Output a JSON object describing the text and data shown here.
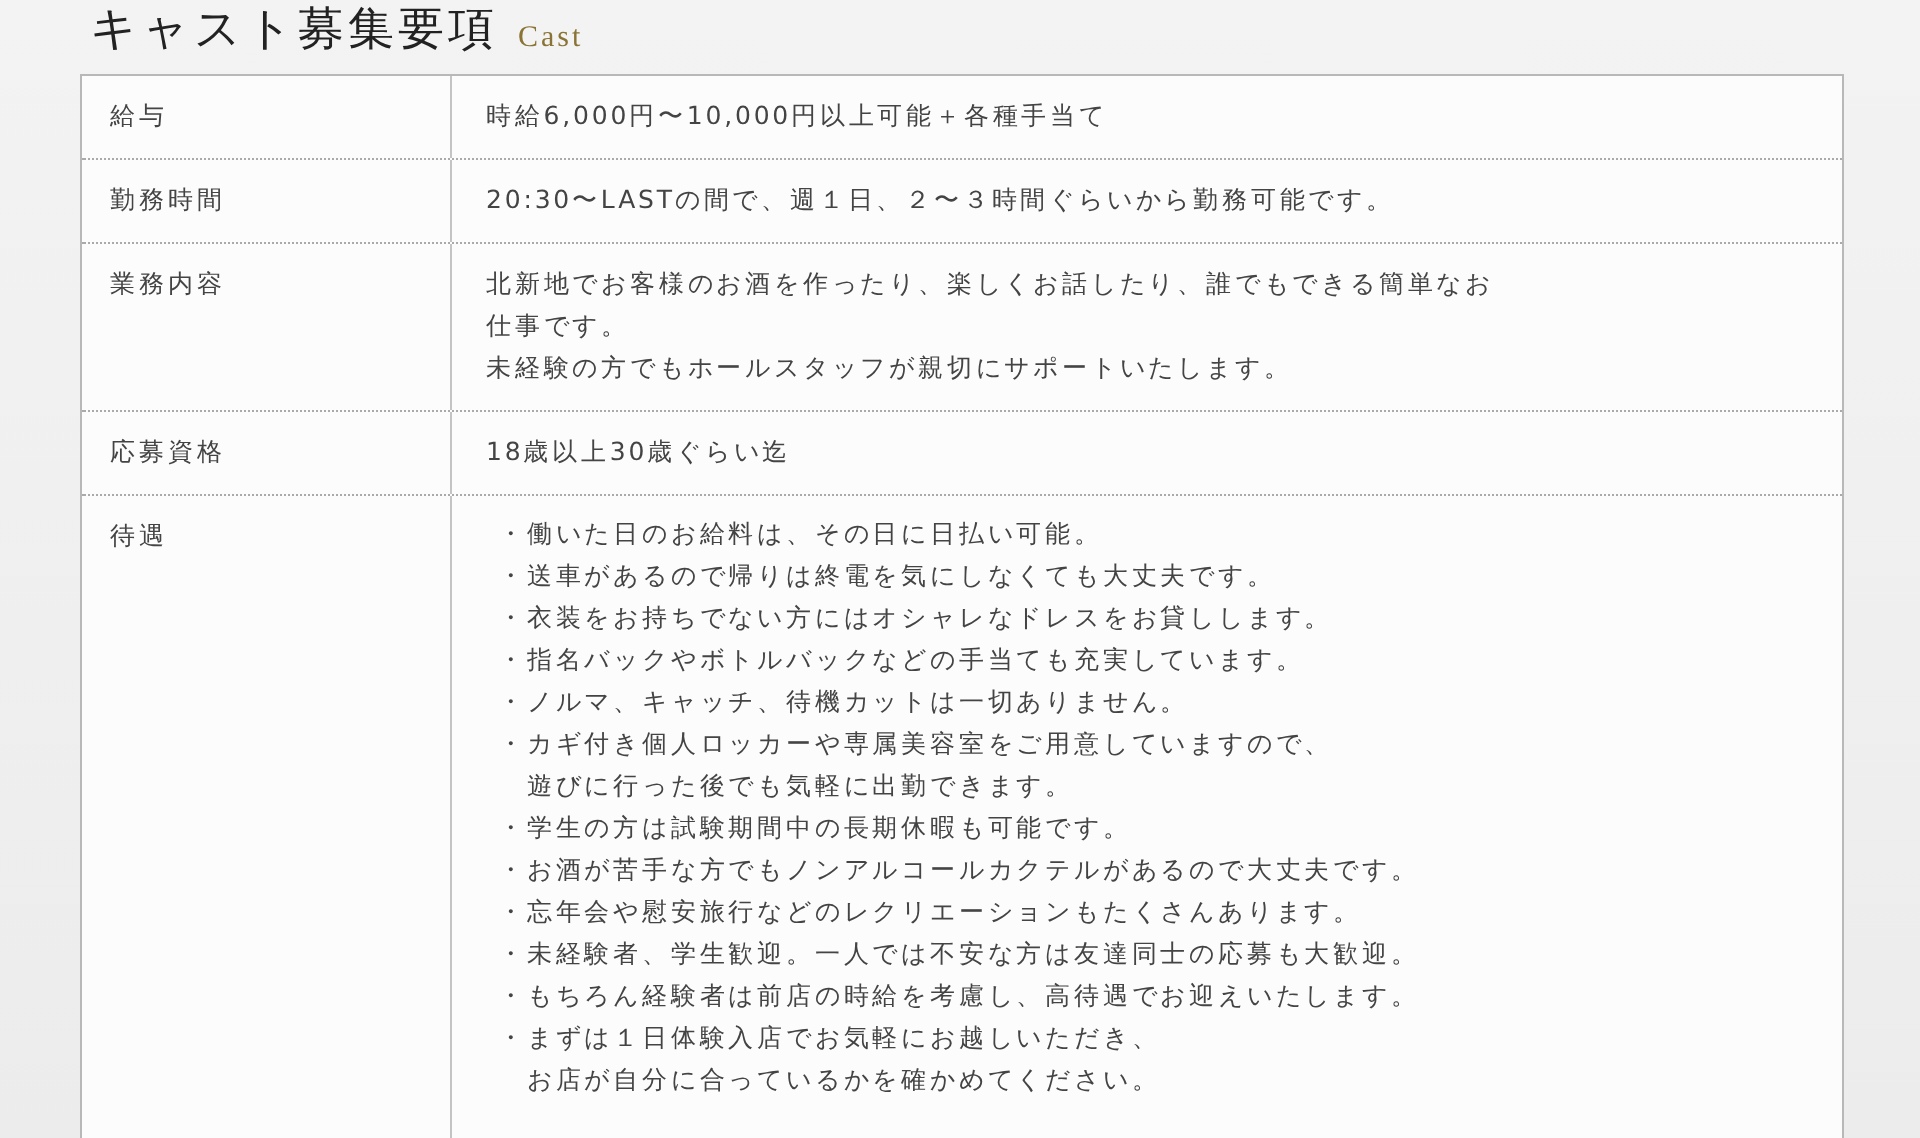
{
  "heading": {
    "title": "キャスト募集要項",
    "subtitle": "Cast"
  },
  "rows": [
    {
      "label": "給与",
      "kind": "text",
      "lines": [
        "時給6,000円〜10,000円以上可能＋各種手当て"
      ]
    },
    {
      "label": "勤務時間",
      "kind": "text",
      "lines": [
        "20:30〜LASTの間で、週１日、２〜３時間ぐらいから勤務可能です。"
      ]
    },
    {
      "label": "業務内容",
      "kind": "text",
      "lines": [
        "北新地でお客様のお酒を作ったり、楽しくお話したり、誰でもできる簡単なお",
        "仕事です。",
        "未経験の方でもホールスタッフが親切にサポートいたします。"
      ]
    },
    {
      "label": "応募資格",
      "kind": "text",
      "lines": [
        "18歳以上30歳ぐらい迄"
      ]
    },
    {
      "label": "待遇",
      "kind": "list",
      "items": [
        {
          "lines": [
            "・働いた日のお給料は、その日に日払い可能。"
          ]
        },
        {
          "lines": [
            "・送車があるので帰りは終電を気にしなくても大丈夫です。"
          ]
        },
        {
          "lines": [
            "・衣装をお持ちでない方にはオシャレなドレスをお貸しします。"
          ]
        },
        {
          "lines": [
            "・指名バックやボトルバックなどの手当ても充実しています。"
          ]
        },
        {
          "lines": [
            "・ノルマ、キャッチ、待機カットは一切ありません。"
          ]
        },
        {
          "lines": [
            "・カギ付き個人ロッカーや専属美容室をご用意していますので、",
            "遊びに行った後でも気軽に出勤できます。"
          ]
        },
        {
          "lines": [
            "・学生の方は試験期間中の長期休暇も可能です。"
          ]
        },
        {
          "lines": [
            "・お酒が苦手な方でもノンアルコールカクテルがあるので大丈夫です。"
          ]
        },
        {
          "lines": [
            "・忘年会や慰安旅行などのレクリエーションもたくさんあります。"
          ]
        },
        {
          "lines": [
            "・未経験者、学生歓迎。一人では不安な方は友達同士の応募も大歓迎。"
          ]
        },
        {
          "lines": [
            "・もちろん経験者は前店の時給を考慮し、高待遇でお迎えいたします。"
          ]
        },
        {
          "lines": [
            "・まずは１日体験入店でお気軽にお越しいただき、",
            "お店が自分に合っているかを確かめてください。"
          ]
        }
      ]
    }
  ]
}
